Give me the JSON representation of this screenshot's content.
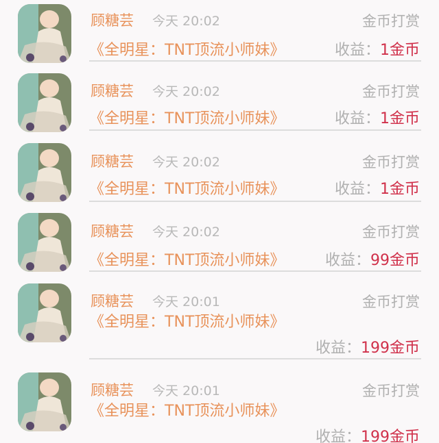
{
  "colors": {
    "accent": "#e8925a",
    "earning": "#d0304a",
    "muted": "#b0b0b0",
    "background": "#faf8f9"
  },
  "records": [
    {
      "name": "顾糖芸",
      "time": "今天 20:02",
      "action": "金币打赏",
      "book": "《全明星：TNT顶流小师妹》",
      "earn_label": "收益：",
      "earn_value": "1金币",
      "avatar_icon": "anime-avatar-icon"
    },
    {
      "name": "顾糖芸",
      "time": "今天 20:02",
      "action": "金币打赏",
      "book": "《全明星：TNT顶流小师妹》",
      "earn_label": "收益：",
      "earn_value": "1金币",
      "avatar_icon": "anime-avatar-icon"
    },
    {
      "name": "顾糖芸",
      "time": "今天 20:02",
      "action": "金币打赏",
      "book": "《全明星：TNT顶流小师妹》",
      "earn_label": "收益：",
      "earn_value": "1金币",
      "avatar_icon": "anime-avatar-icon"
    },
    {
      "name": "顾糖芸",
      "time": "今天 20:02",
      "action": "金币打赏",
      "book": "《全明星：TNT顶流小师妹》",
      "earn_label": "收益：",
      "earn_value": "99金币",
      "avatar_icon": "anime-avatar-icon"
    },
    {
      "name": "顾糖芸",
      "time": "今天 20:01",
      "action": "金币打赏",
      "book": "《全明星：TNT顶流小师妹》",
      "earn_label": "收益：",
      "earn_value": "199金币",
      "avatar_icon": "anime-avatar-icon"
    },
    {
      "name": "顾糖芸",
      "time": "今天 20:01",
      "action": "金币打赏",
      "book": "《全明星：TNT顶流小师妹》",
      "earn_label": "收益：",
      "earn_value": "199金币",
      "avatar_icon": "anime-avatar-icon"
    }
  ]
}
